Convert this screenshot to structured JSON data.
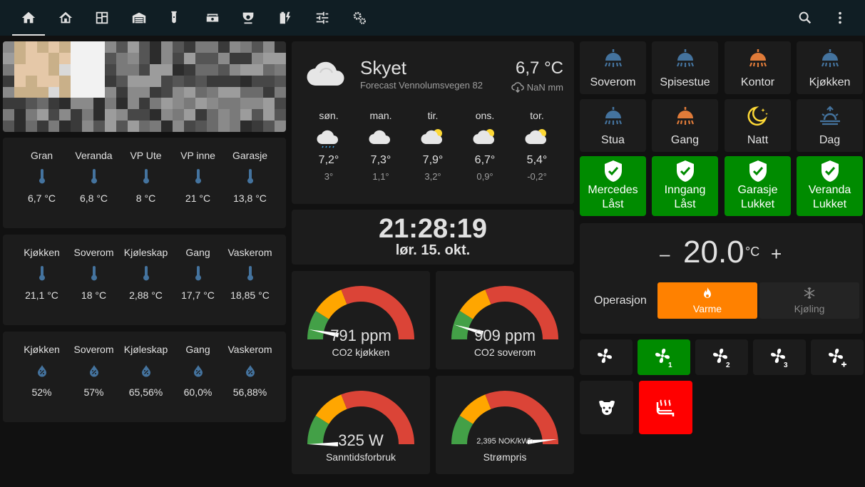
{
  "header": {
    "tabs": [
      {
        "icon": "home-icon",
        "active": true
      },
      {
        "icon": "house-outline-icon"
      },
      {
        "icon": "floor-plan-icon"
      },
      {
        "icon": "garage-icon"
      },
      {
        "icon": "test-tube-icon"
      },
      {
        "icon": "robot-vacuum-icon"
      },
      {
        "icon": "cctv-icon"
      },
      {
        "icon": "battery-charging-icon"
      },
      {
        "icon": "tune-sliders-icon"
      },
      {
        "icon": "cogs-icon"
      }
    ],
    "actions": [
      "search-icon",
      "more-vertical-icon"
    ]
  },
  "temps_outdoor": [
    {
      "name": "Gran",
      "value": "6,7 °C"
    },
    {
      "name": "Veranda",
      "value": "6,8 °C"
    },
    {
      "name": "VP Ute",
      "value": "8 °C"
    },
    {
      "name": "VP inne",
      "value": "21 °C"
    },
    {
      "name": "Garasje",
      "value": "13,8 °C"
    }
  ],
  "temps_indoor": [
    {
      "name": "Kjøkken",
      "value": "21,1 °C"
    },
    {
      "name": "Soverom",
      "value": "18 °C"
    },
    {
      "name": "Kjøleskap",
      "value": "2,88 °C"
    },
    {
      "name": "Gang",
      "value": "17,7 °C"
    },
    {
      "name": "Vaskerom",
      "value": "18,85 °C"
    }
  ],
  "humidity": [
    {
      "name": "Kjøkken",
      "value": "52%"
    },
    {
      "name": "Soverom",
      "value": "57%"
    },
    {
      "name": "Kjøleskap",
      "value": "65,56%"
    },
    {
      "name": "Gang",
      "value": "60,0%"
    },
    {
      "name": "Vaskerom",
      "value": "56,88%"
    }
  ],
  "weather": {
    "condition": "Skyet",
    "location": "Forecast Vennolumsvegen 82",
    "temperature": "6,7 °C",
    "precipitation": "NaN mm",
    "forecast": [
      {
        "day": "søn.",
        "high": "7,2°",
        "low": "3°",
        "icon": "rainy-cloud-icon"
      },
      {
        "day": "man.",
        "high": "7,3°",
        "low": "1,1°",
        "icon": "cloudy-icon"
      },
      {
        "day": "tir.",
        "high": "7,9°",
        "low": "3,2°",
        "icon": "partly-cloudy-icon"
      },
      {
        "day": "ons.",
        "high": "6,7°",
        "low": "0,9°",
        "icon": "partly-cloudy-icon"
      },
      {
        "day": "tor.",
        "high": "5,4°",
        "low": "-0,2°",
        "icon": "partly-cloudy-icon"
      }
    ]
  },
  "clock": {
    "time": "21:28:19",
    "date": "lør. 15. okt."
  },
  "gauges": [
    {
      "value_text": "791 ppm",
      "label": "CO2 kjøkken",
      "fraction": 0.06
    },
    {
      "value_text": "909 ppm",
      "label": "CO2 soverom",
      "fraction": 0.09
    },
    {
      "value_text": "325 W",
      "label": "Sanntidsforbruk",
      "fraction": 0.0
    },
    {
      "value_text": "2,395 NOK/kWh",
      "label": "Strømpris",
      "fraction": 0.97
    }
  ],
  "light_tiles": [
    {
      "label": "Soverom",
      "icon": "ceiling-light-icon",
      "color": "#44739e"
    },
    {
      "label": "Spisestue",
      "icon": "ceiling-light-icon",
      "color": "#44739e"
    },
    {
      "label": "Kontor",
      "icon": "ceiling-light-icon",
      "color": "#e07b39"
    },
    {
      "label": "Kjøkken",
      "icon": "ceiling-light-icon",
      "color": "#44739e"
    },
    {
      "label": "Stua",
      "icon": "ceiling-light-icon",
      "color": "#44739e"
    },
    {
      "label": "Gang",
      "icon": "ceiling-light-icon",
      "color": "#e07b39"
    },
    {
      "label": "Natt",
      "icon": "moon-stars-icon",
      "color": "#fdd835"
    },
    {
      "label": "Dag",
      "icon": "sunrise-icon",
      "color": "#44739e"
    }
  ],
  "lock_tiles": [
    {
      "line1": "Mercedes",
      "line2": "Låst"
    },
    {
      "line1": "Inngang",
      "line2": "Låst"
    },
    {
      "line1": "Garasje",
      "line2": "Lukket"
    },
    {
      "line1": "Veranda",
      "line2": "Lukket"
    }
  ],
  "thermostat": {
    "minus": "–",
    "setpoint": "20.0",
    "unit": "°C",
    "plus": "+",
    "operation_label": "Operasjon",
    "heat_label": "Varme",
    "cool_label": "Kjøling"
  },
  "fan_buttons": [
    {
      "icon": "fan-icon",
      "active": false
    },
    {
      "icon": "fan-speed-1-icon",
      "active": true
    },
    {
      "icon": "fan-speed-2-icon",
      "active": false
    },
    {
      "icon": "fan-speed-3-icon",
      "active": false
    },
    {
      "icon": "fan-plus-icon",
      "active": false
    }
  ],
  "extra_buttons": [
    {
      "icon": "dog-icon",
      "active": false
    },
    {
      "icon": "heated-seat-icon",
      "active": true
    }
  ],
  "colors": {
    "accent_blue": "#44739e",
    "active_green": "#008b00",
    "heat_orange": "#ff8100",
    "alert_red": "#ff0000",
    "gauge_green": "#43a047",
    "gauge_yellow": "#ffa600",
    "gauge_red": "#db4437"
  }
}
